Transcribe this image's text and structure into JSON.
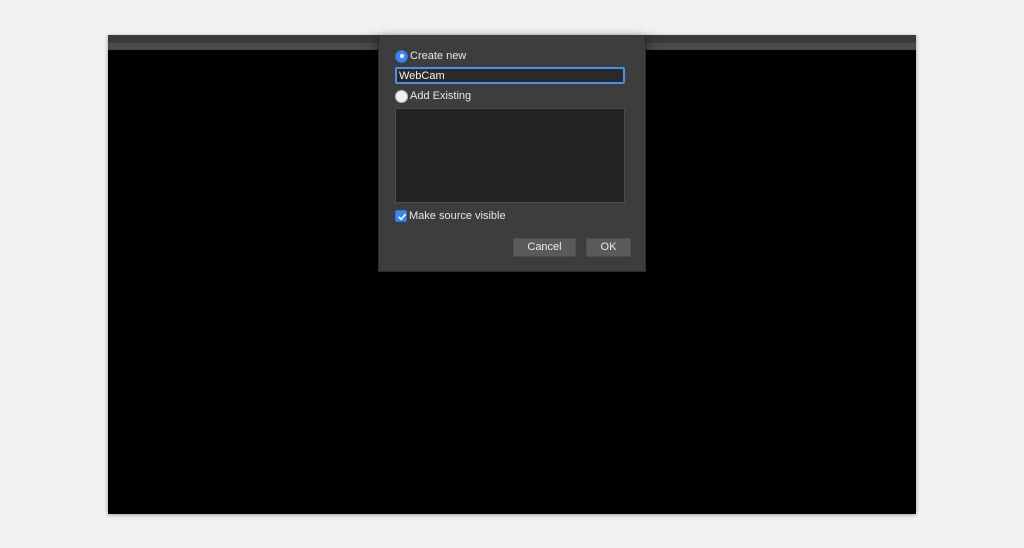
{
  "dialog": {
    "create_new_label": "Create new",
    "create_new_selected": true,
    "name_value": "WebCam",
    "add_existing_label": "Add Existing",
    "add_existing_selected": false,
    "make_visible_label": "Make source visible",
    "make_visible_checked": true,
    "cancel_label": "Cancel",
    "ok_label": "OK"
  },
  "icons": {
    "radio_selected": "radio-selected-icon",
    "radio_unselected": "radio-unselected-icon",
    "checkbox_checked": "checkmark-icon"
  },
  "colors": {
    "accent": "#3b86f0",
    "dialog_bg": "#3d3d3d",
    "preview_bg": "#000000",
    "page_bg": "#f3f2f3"
  }
}
